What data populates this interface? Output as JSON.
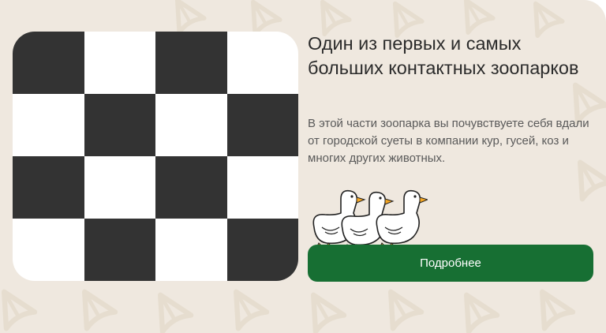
{
  "card": {
    "background_color": "#efe8df",
    "pattern_icon": "duck-footprint-icon",
    "image": {
      "icon": "image-placeholder-checkerboard",
      "dark_color": "#333333",
      "light_color": "#ffffff"
    },
    "title": "Один из первых и самых больших контактных зоопарков",
    "description": "В этой части зоопарка вы почувствуете себя вдали от городской суеты в компании кур, гусей, коз и многих других животных.",
    "illustration_icon": "geese-illustration-icon",
    "button": {
      "label": "Подробнее",
      "color": "#176f33"
    }
  }
}
